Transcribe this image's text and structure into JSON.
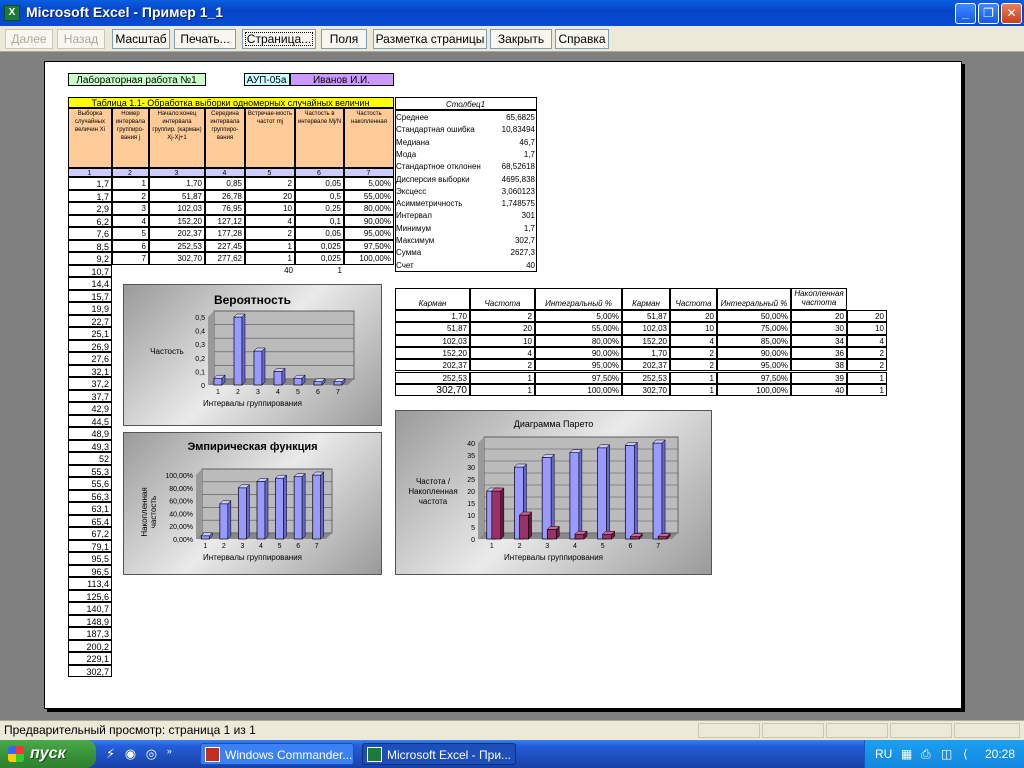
{
  "window": {
    "title": "Microsoft Excel - Пример 1_1",
    "app_icon": "X"
  },
  "toolbar": {
    "buttons": [
      "Далее",
      "Назад",
      "Масштаб",
      "Печать...",
      "Страница...",
      "Поля",
      "Разметка страницы",
      "Закрыть",
      "Справка"
    ]
  },
  "tags": {
    "lab": "Лабораторная работа №1",
    "group": "АУП-05а",
    "name": "Иванов И.И."
  },
  "main_table": {
    "title": "Таблица 1.1- Обработка выборки одномерных случайных величин",
    "headers": [
      "Выборка случайных величин Xi",
      "Номер интервала группиро-вания j",
      "Начало:конец интервала группир. (карман) Xj-Xj+1",
      "Середина интервала группиро-вания",
      "Встречае-мость частот mj",
      "Частость в интервале Mj/N",
      "Частость накопленная"
    ],
    "nums": [
      "1",
      "2",
      "3",
      "4",
      "5",
      "6",
      "7"
    ],
    "col1": [
      "1,7",
      "1,7",
      "2,9",
      "6,2",
      "7,6",
      "8,5",
      "9,2",
      "10,7",
      "14,4",
      "15,7",
      "19,9",
      "22,7",
      "25,1",
      "26,9",
      "27,6",
      "32,1",
      "37,2",
      "37,7",
      "42,9",
      "44,5",
      "48,9",
      "49,3",
      "52",
      "55,3",
      "55,6",
      "56,3",
      "63,1",
      "65,4",
      "67,2",
      "79,1",
      "95,5",
      "96,5",
      "113,4",
      "125,6",
      "140,7",
      "148,9",
      "187,3",
      "200,2",
      "229,1",
      "302,7"
    ],
    "rows": [
      [
        "1",
        "1,70",
        "0,85",
        "2",
        "0,05",
        "5,00%"
      ],
      [
        "2",
        "51,87",
        "26,78",
        "20",
        "0,5",
        "55,00%"
      ],
      [
        "3",
        "102,03",
        "76,95",
        "10",
        "0,25",
        "80,00%"
      ],
      [
        "4",
        "152,20",
        "127,12",
        "4",
        "0,1",
        "90,00%"
      ],
      [
        "5",
        "202,37",
        "177,28",
        "2",
        "0,05",
        "95,00%"
      ],
      [
        "6",
        "252,53",
        "227,45",
        "1",
        "0,025",
        "97,50%"
      ],
      [
        "7",
        "302,70",
        "277,62",
        "1",
        "0,025",
        "100,00%"
      ]
    ],
    "totals": [
      "40",
      "1"
    ]
  },
  "stats": {
    "title": "Столбец1",
    "rows": [
      [
        "Среднее",
        "65,6825"
      ],
      [
        "Стандартная ошибка",
        "10,83494"
      ],
      [
        "Медиана",
        "46,7"
      ],
      [
        "Мода",
        "1,7"
      ],
      [
        "Стандартное отклонение",
        "68,52618"
      ],
      [
        "Дисперсия выборки",
        "4695,838"
      ],
      [
        "Эксцесс",
        "3,060123"
      ],
      [
        "Асимметричность",
        "1,748575"
      ],
      [
        "Интервал",
        "301"
      ],
      [
        "Минимум",
        "1,7"
      ],
      [
        "Максимум",
        "302,7"
      ],
      [
        "Сумма",
        "2627,3"
      ],
      [
        "Счет",
        "40"
      ]
    ]
  },
  "pareto_table": {
    "headers": [
      "Карман",
      "Частота",
      "Интегральный %",
      "Карман",
      "Частота",
      "Интегральный %",
      "Накопленная частота"
    ],
    "rows": [
      [
        "1,70",
        "2",
        "5,00%",
        "51,87",
        "20",
        "50,00%",
        "20",
        "20"
      ],
      [
        "51,87",
        "20",
        "55,00%",
        "102,03",
        "10",
        "75,00%",
        "30",
        "10"
      ],
      [
        "102,03",
        "10",
        "80,00%",
        "152,20",
        "4",
        "85,00%",
        "34",
        "4"
      ],
      [
        "152,20",
        "4",
        "90,00%",
        "1,70",
        "2",
        "90,00%",
        "36",
        "2"
      ],
      [
        "202,37",
        "2",
        "95,00%",
        "202,37",
        "2",
        "95,00%",
        "38",
        "2"
      ],
      [
        "252,53",
        "1",
        "97,50%",
        "252,53",
        "1",
        "97,50%",
        "39",
        "1"
      ],
      [
        "302,70",
        "1",
        "100,00%",
        "302,70",
        "1",
        "100,00%",
        "40",
        "1"
      ]
    ]
  },
  "chart_data": [
    {
      "type": "bar",
      "title": "Вероятность",
      "xlabel": "Интервалы группирования",
      "ylabel": "Частость",
      "categories": [
        "1",
        "2",
        "3",
        "4",
        "5",
        "6",
        "7"
      ],
      "values": [
        0.05,
        0.5,
        0.25,
        0.1,
        0.05,
        0.025,
        0.025
      ],
      "ylim": [
        0,
        0.5
      ],
      "yticks": [
        "0",
        "0,1",
        "0,2",
        "0,3",
        "0,4",
        "0,5"
      ]
    },
    {
      "type": "bar",
      "title": "Эмпирическая функция",
      "xlabel": "Интервалы группирования",
      "ylabel": "Накопленная частость",
      "categories": [
        "1",
        "2",
        "3",
        "4",
        "5",
        "6",
        "7"
      ],
      "values": [
        0.05,
        0.55,
        0.8,
        0.9,
        0.95,
        0.975,
        1.0
      ],
      "ylim": [
        0,
        1
      ],
      "yticks": [
        "0,00%",
        "20,00%",
        "40,00%",
        "60,00%",
        "80,00%",
        "100,00%"
      ]
    },
    {
      "type": "bar",
      "title": "Диаграмма Парето",
      "xlabel": "Интервалы группирования",
      "ylabel": "Частота / Накопленная частота",
      "categories": [
        "1",
        "2",
        "3",
        "4",
        "5",
        "6",
        "7"
      ],
      "series": [
        {
          "values": [
            20,
            30,
            34,
            36,
            38,
            39,
            40
          ]
        },
        {
          "values": [
            20,
            10,
            4,
            2,
            2,
            1,
            1
          ]
        }
      ],
      "ylim": [
        0,
        40
      ],
      "yticks": [
        "0",
        "5",
        "10",
        "15",
        "20",
        "25",
        "30",
        "35",
        "40"
      ]
    }
  ],
  "status": {
    "text": "Предварительный просмотр: страница 1 из 1"
  },
  "taskbar": {
    "start": "пуск",
    "tasks": [
      "Windows Commander...",
      "Microsoft Excel - При..."
    ],
    "lang": "RU",
    "clock": "20:28"
  },
  "colors": {
    "title_bg": "#ffff00",
    "header_bg": "#ffcc99",
    "num_bg": "#ccccff",
    "tag_green": "#ccffcc",
    "tag_cyan": "#ccffff",
    "tag_violet": "#cc99ff",
    "bar_blue": "#9999ff",
    "bar_red": "#993366"
  }
}
